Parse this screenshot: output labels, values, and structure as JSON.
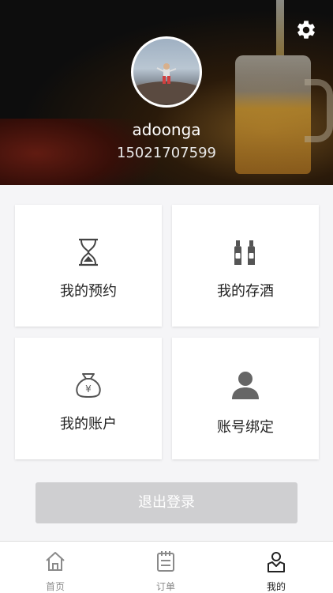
{
  "profile": {
    "username": "adoonga",
    "phone": "15021707599"
  },
  "cards": [
    {
      "label": "我的预约",
      "icon": "hourglass-icon"
    },
    {
      "label": "我的存酒",
      "icon": "bottles-icon"
    },
    {
      "label": "我的账户",
      "icon": "money-bag-icon"
    },
    {
      "label": "账号绑定",
      "icon": "user-icon"
    }
  ],
  "logout_label": "退出登录",
  "tabs": [
    {
      "label": "首页",
      "icon": "home-icon",
      "active": false
    },
    {
      "label": "订单",
      "icon": "order-icon",
      "active": false
    },
    {
      "label": "我的",
      "icon": "profile-icon",
      "active": true
    }
  ],
  "colors": {
    "accent_dark": "#222222",
    "inactive": "#8a8a8a",
    "logout_bg": "#cfcfd1"
  }
}
